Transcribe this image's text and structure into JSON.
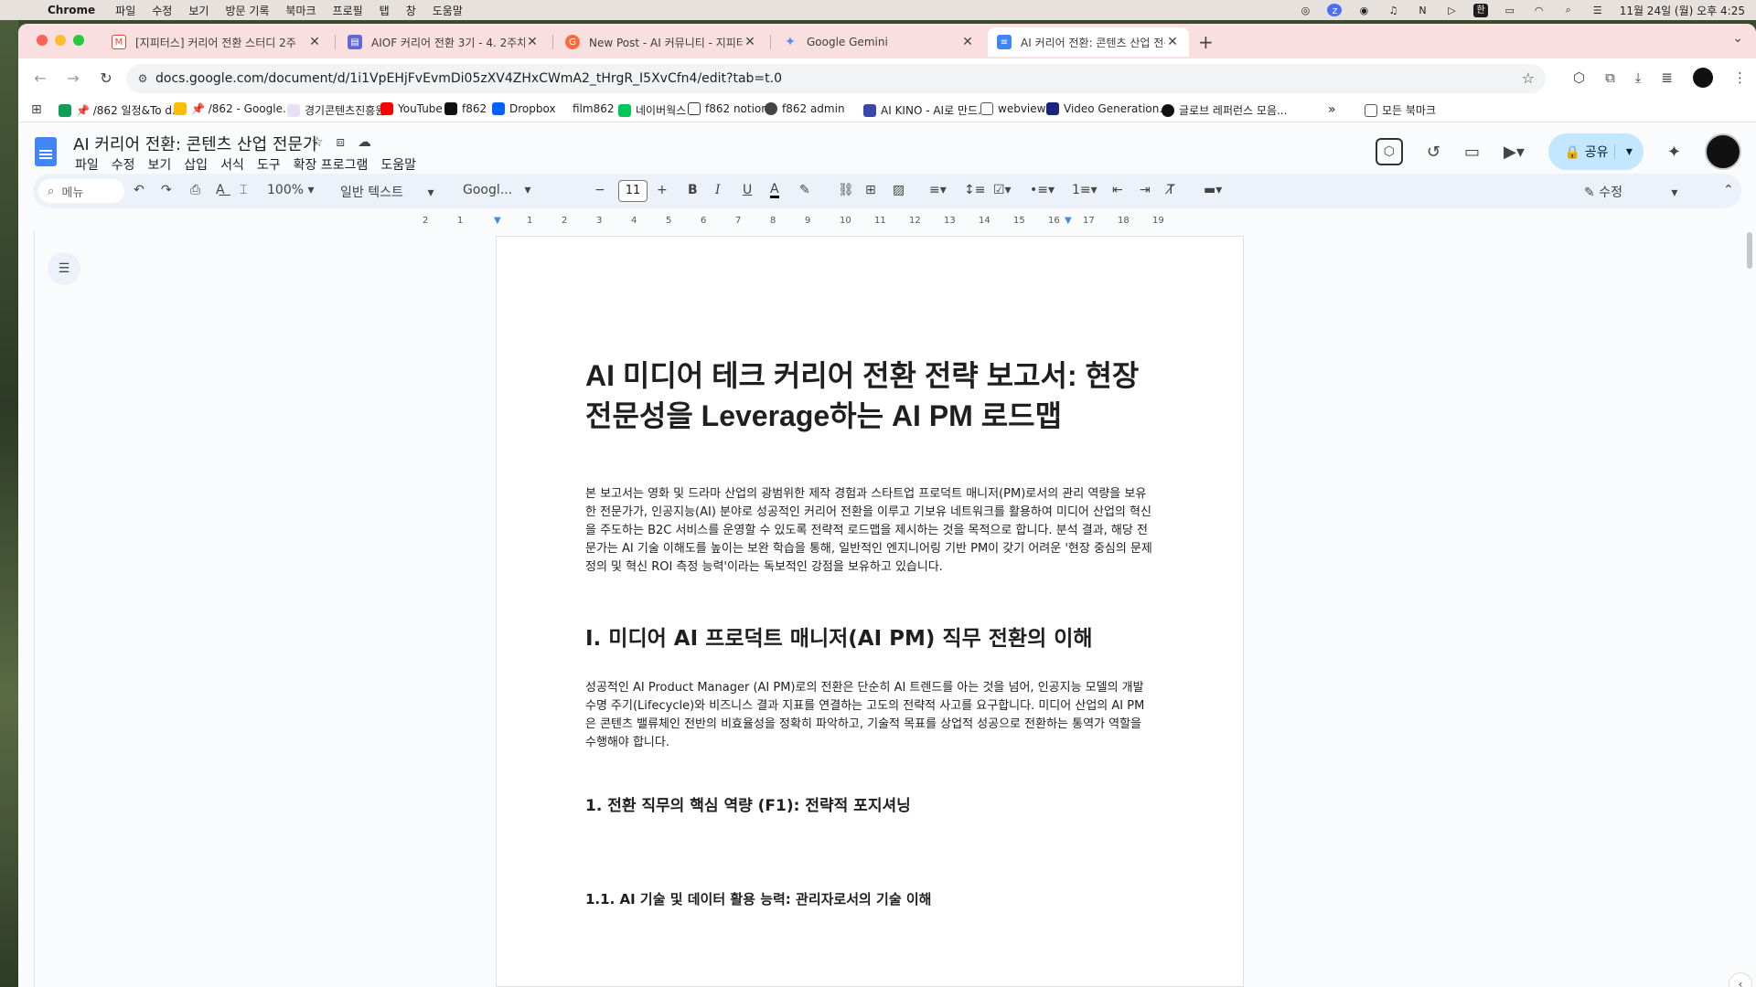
{
  "menubar": {
    "app": "Chrome",
    "items": [
      "파일",
      "수정",
      "보기",
      "방문 기록",
      "북마크",
      "프로필",
      "탭",
      "창",
      "도움말"
    ],
    "input_indicator": "한",
    "clock": "11월 24일 (월) 오후 4:25"
  },
  "tabs": [
    {
      "title": "[지피터스] 커리어 전환 스터디 2주",
      "favicon": "gmail-icon",
      "color": "#ea4335"
    },
    {
      "title": "AIOF 커리어 전환 3기 - 4. 2주차",
      "favicon": "document-icon",
      "color": "#5f6ad6"
    },
    {
      "title": "New Post - AI 커뮤니티 - 지피터",
      "favicon": "gpters-icon",
      "color": "#ff6a3d"
    },
    {
      "title": "Google Gemini",
      "favicon": "gemini-icon",
      "color": "#4f8bf5"
    },
    {
      "title": "AI 커리어 전환: 콘텐츠 산업 전문가",
      "favicon": "docs-icon",
      "color": "#4285f4"
    }
  ],
  "url": "docs.google.com/document/d/1i1VpEHjFvEvmDi05zXV4ZHxCWmA2_tHrgR_I5XvCfn4/edit?tab=t.0",
  "bookmarks": {
    "items": [
      "📌 /862 일정&To d...",
      "📌 /862 - Google...",
      "경기콘텐츠진흥원",
      "YouTube",
      "f862",
      "Dropbox",
      "film862",
      "네이버웍스",
      "f862 notion",
      "f862 admin",
      "AI KINO - AI로 만드...",
      "webview",
      "Video Generation...",
      "글로브 레퍼런스 모음..."
    ],
    "overflow": "»",
    "all_bookmarks": "모든 북마크"
  },
  "docs": {
    "title": "AI 커리어 전환: 콘텐츠 산업 전문가",
    "menu": [
      "파일",
      "수정",
      "보기",
      "삽입",
      "서식",
      "도구",
      "확장 프로그램",
      "도움말"
    ],
    "share_label": "공유",
    "toolbar": {
      "search_placeholder": "메뉴",
      "zoom": "100%",
      "style": "일반 텍스트",
      "font": "Googl...",
      "font_size": "11",
      "mode": "수정"
    },
    "ruler": [
      "2",
      "1",
      "1",
      "2",
      "3",
      "4",
      "5",
      "6",
      "7",
      "8",
      "9",
      "10",
      "11",
      "12",
      "13",
      "14",
      "15",
      "16",
      "17",
      "18",
      "19"
    ]
  },
  "document": {
    "title": "AI 미디어 테크 커리어 전환 전략 보고서: 현장 전문성을 Leverage하는 AI PM 로드맵",
    "intro": "본 보고서는 영화 및 드라마 산업의 광범위한 제작 경험과 스타트업 프로덕트 매니저(PM)로서의 관리 역량을 보유한 전문가가, 인공지능(AI) 분야로 성공적인 커리어 전환을 이루고 기보유 네트워크를 활용하여 미디어 산업의 혁신을 주도하는 B2C 서비스를 운영할 수 있도록 전략적 로드맵을 제시하는 것을 목적으로 합니다. 분석 결과, 해당 전문가는 AI 기술 이해도를 높이는 보완 학습을 통해, 일반적인 엔지니어링 기반 PM이 갖기 어려운 '현장 중심의 문제 정의 및 혁신 ROI 측정 능력'이라는 독보적인 강점을 보유하고 있습니다.",
    "section1": "I. 미디어 AI 프로덕트 매니저(AI PM) 직무 전환의 이해",
    "section1_body": "성공적인 AI Product Manager (AI PM)로의 전환은 단순히 AI 트렌드를 아는 것을 넘어, 인공지능 모델의 개발 수명 주기(Lifecycle)와 비즈니스 결과 지표를 연결하는 고도의 전략적 사고를 요구합니다. 미디어 산업의 AI PM은 콘텐츠 밸류체인 전반의 비효율성을 정확히 파악하고, 기술적 목표를 상업적 성공으로 전환하는 통역가 역할을 수행해야 합니다.",
    "section1_1": "1. 전환 직무의 핵심 역량 (F1): 전략적 포지셔닝",
    "section1_1_1": "1.1. AI 기술 및 데이터 활용 능력: 관리자로서의 기술 이해"
  }
}
